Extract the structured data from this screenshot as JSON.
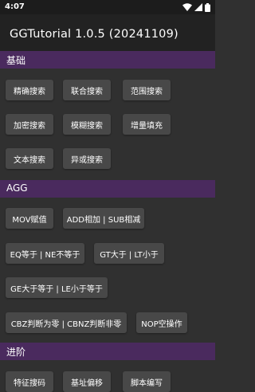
{
  "status_bar": {
    "time": "4:07",
    "icons": [
      "wifi-icon",
      "signal-icon",
      "battery-icon"
    ]
  },
  "app_bar": {
    "title": "GGTutorial 1.0.5 (20241109)"
  },
  "sections": [
    {
      "title": "基础",
      "buttons": [
        "精确搜索",
        "联合搜索",
        "范围搜索",
        "加密搜索",
        "模糊搜索",
        "增量填充",
        "文本搜索",
        "异或搜索"
      ]
    },
    {
      "title": "AGG",
      "buttons": [
        "MOV赋值",
        "ADD相加 | SUB相减",
        "EQ等于 | NE不等于",
        "GT大于 | LT小于",
        "GE大于等于 | LE小于等于",
        "CBZ判断为零 | CBNZ判断非零",
        "NOP空操作"
      ]
    },
    {
      "title": "进阶",
      "buttons": [
        "特征搜码",
        "基址偏移",
        "脚本编写"
      ]
    }
  ],
  "colors": {
    "background": "#303030",
    "app_bar": "#222222",
    "section_header": "#4a2a5e",
    "button": "#484848",
    "text": "#ffffff"
  }
}
